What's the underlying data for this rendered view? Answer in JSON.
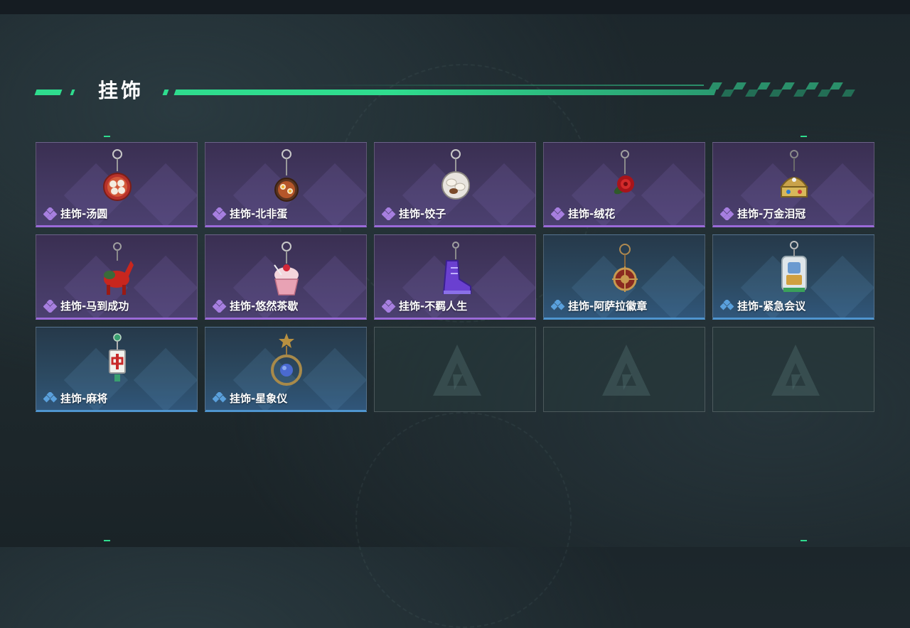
{
  "header": {
    "title": "挂饰"
  },
  "colors": {
    "accent": "#2fdc8e",
    "purple_rarity": "#9a6ad8",
    "blue_rarity": "#4f95cf"
  },
  "items": [
    {
      "label": "挂饰-汤圆",
      "rarity": "purple",
      "icon": "tangyuan-charm-icon"
    },
    {
      "label": "挂饰-北非蛋",
      "rarity": "purple",
      "icon": "shakshuka-charm-icon"
    },
    {
      "label": "挂饰-饺子",
      "rarity": "purple",
      "icon": "dumpling-charm-icon"
    },
    {
      "label": "挂饰-绒花",
      "rarity": "purple",
      "icon": "velvet-flower-charm-icon"
    },
    {
      "label": "挂饰-万金泪冠",
      "rarity": "purple",
      "icon": "crown-charm-icon"
    },
    {
      "label": "挂饰-马到成功",
      "rarity": "purple",
      "icon": "horse-charm-icon"
    },
    {
      "label": "挂饰-悠然茶歇",
      "rarity": "purple",
      "icon": "cupcake-charm-icon"
    },
    {
      "label": "挂饰-不羁人生",
      "rarity": "purple",
      "icon": "sneaker-charm-icon"
    },
    {
      "label": "挂饰-阿萨拉徽章",
      "rarity": "blue",
      "icon": "badge-charm-icon"
    },
    {
      "label": "挂饰-紧急会议",
      "rarity": "blue",
      "icon": "acrylic-stand-charm-icon"
    },
    {
      "label": "挂饰-麻将",
      "rarity": "blue",
      "icon": "mahjong-tile-charm-icon"
    },
    {
      "label": "挂饰-星象仪",
      "rarity": "blue",
      "icon": "astrolabe-charm-icon"
    }
  ],
  "empty_slots": 3
}
